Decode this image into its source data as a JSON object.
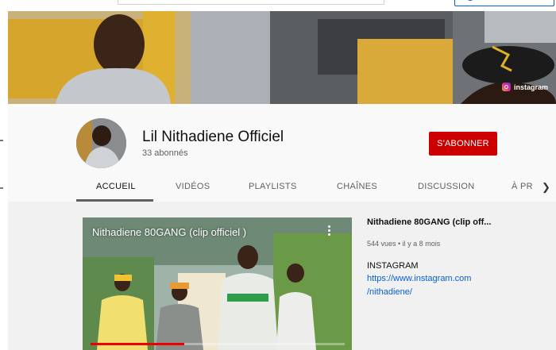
{
  "channel": {
    "name": "Lil Nithadiene Officiel",
    "subscribers": "33 abonnés",
    "subscribe_label": "S'ABONNER"
  },
  "banner": {
    "instagram_label": "instagram"
  },
  "tabs": [
    {
      "label": "ACCUEIL",
      "active": true
    },
    {
      "label": "VIDÉOS",
      "active": false
    },
    {
      "label": "PLAYLISTS",
      "active": false
    },
    {
      "label": "CHAÎNES",
      "active": false
    },
    {
      "label": "DISCUSSION",
      "active": false
    },
    {
      "label": "À PR",
      "active": false
    }
  ],
  "tabs_more_icon": "chevron-right-icon",
  "featured_video": {
    "player_title": "Nithadiene 80GANG (clip officiel )",
    "title": "Nithadiene 80GANG (clip off...",
    "meta": "544 vues • il y a 8 mois",
    "description_label": "INSTAGRAM",
    "link_line1": "https://www.instagram.com",
    "link_line2": "/nithadiene/",
    "progress": 0.37
  },
  "colors": {
    "subscribe": "#cc0000",
    "link": "#065fd4",
    "progress": "#ee0000"
  }
}
